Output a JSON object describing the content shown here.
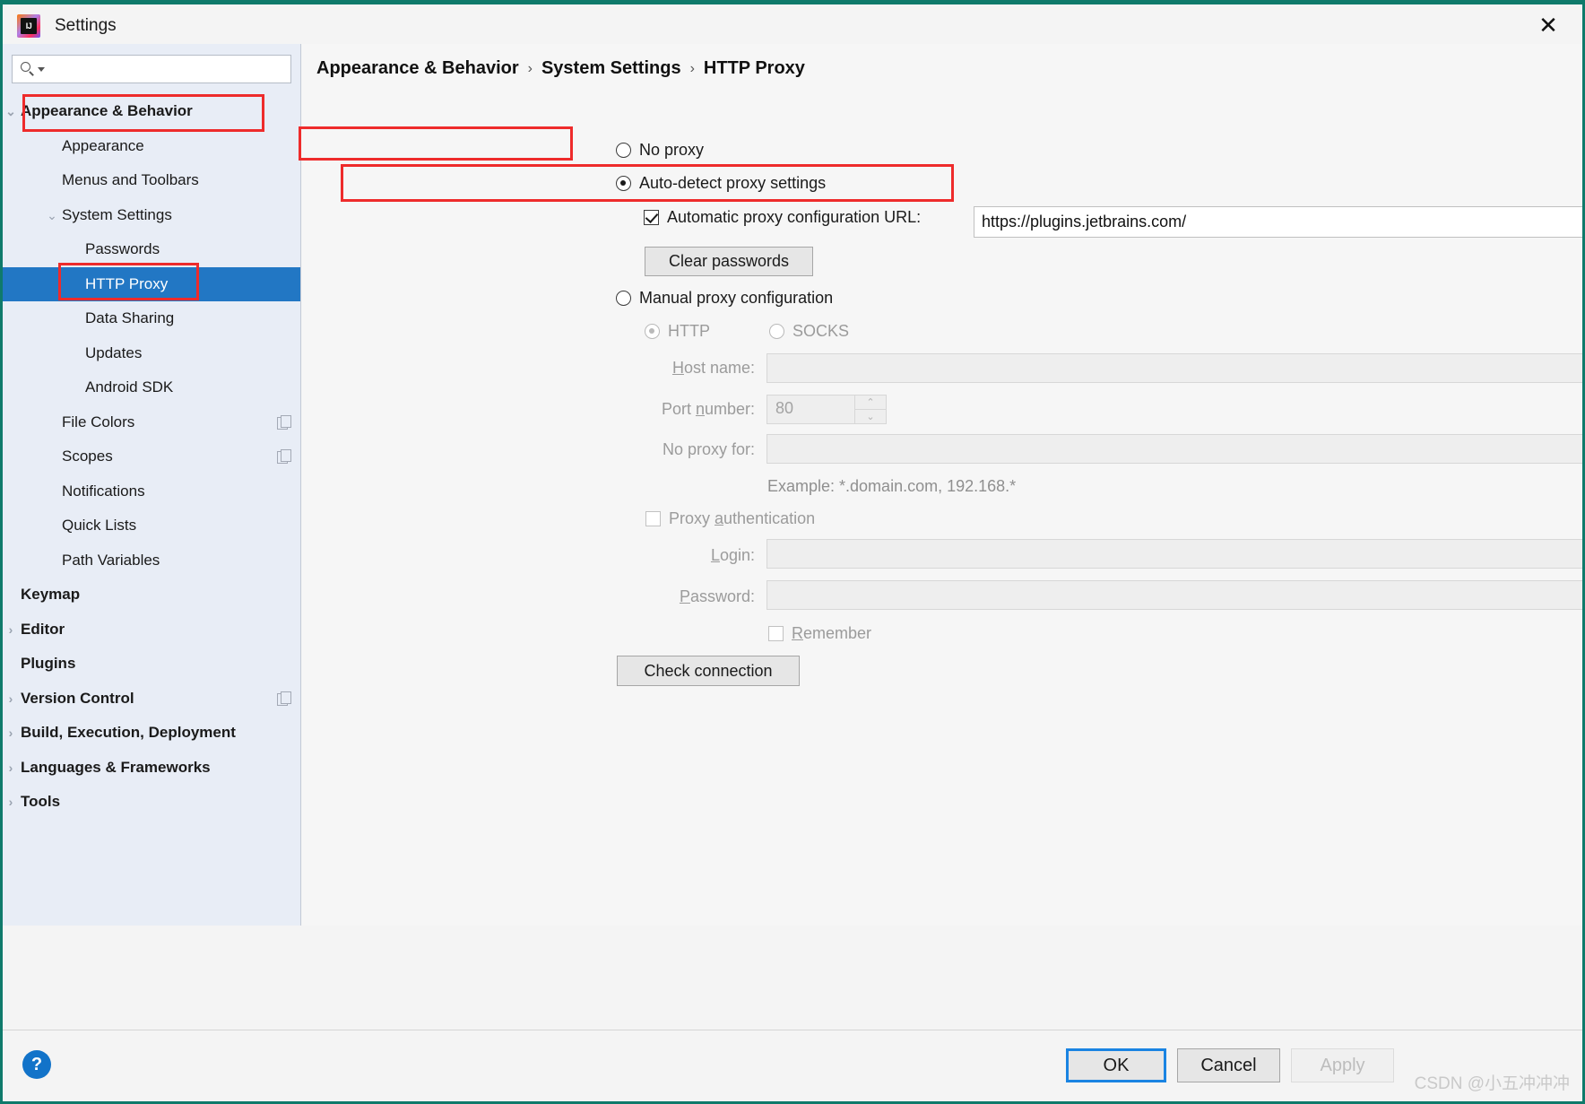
{
  "window": {
    "title": "Settings",
    "logo_text": "IJ",
    "close_icon": "✕"
  },
  "sidebar": {
    "search": {
      "value": "",
      "placeholder": ""
    },
    "items": [
      {
        "label": "Appearance & Behavior",
        "indent": 0,
        "bold": true,
        "twisty": "⌄",
        "selected": false,
        "copy": false
      },
      {
        "label": "Appearance",
        "indent": 1,
        "bold": false,
        "twisty": "",
        "selected": false,
        "copy": false
      },
      {
        "label": "Menus and Toolbars",
        "indent": 1,
        "bold": false,
        "twisty": "",
        "selected": false,
        "copy": false
      },
      {
        "label": "System Settings",
        "indent": 1,
        "bold": false,
        "twisty": "⌄",
        "selected": false,
        "copy": false
      },
      {
        "label": "Passwords",
        "indent": 2,
        "bold": false,
        "twisty": "",
        "selected": false,
        "copy": false
      },
      {
        "label": "HTTP Proxy",
        "indent": 2,
        "bold": false,
        "twisty": "",
        "selected": true,
        "copy": false
      },
      {
        "label": "Data Sharing",
        "indent": 2,
        "bold": false,
        "twisty": "",
        "selected": false,
        "copy": false
      },
      {
        "label": "Updates",
        "indent": 2,
        "bold": false,
        "twisty": "",
        "selected": false,
        "copy": false
      },
      {
        "label": "Android SDK",
        "indent": 2,
        "bold": false,
        "twisty": "",
        "selected": false,
        "copy": false
      },
      {
        "label": "File Colors",
        "indent": 1,
        "bold": false,
        "twisty": "",
        "selected": false,
        "copy": true
      },
      {
        "label": "Scopes",
        "indent": 1,
        "bold": false,
        "twisty": "",
        "selected": false,
        "copy": true
      },
      {
        "label": "Notifications",
        "indent": 1,
        "bold": false,
        "twisty": "",
        "selected": false,
        "copy": false
      },
      {
        "label": "Quick Lists",
        "indent": 1,
        "bold": false,
        "twisty": "",
        "selected": false,
        "copy": false
      },
      {
        "label": "Path Variables",
        "indent": 1,
        "bold": false,
        "twisty": "",
        "selected": false,
        "copy": false
      },
      {
        "label": "Keymap",
        "indent": 0,
        "bold": true,
        "twisty": "",
        "selected": false,
        "copy": false
      },
      {
        "label": "Editor",
        "indent": 0,
        "bold": true,
        "twisty": "›",
        "selected": false,
        "copy": false
      },
      {
        "label": "Plugins",
        "indent": 0,
        "bold": true,
        "twisty": "",
        "selected": false,
        "copy": false
      },
      {
        "label": "Version Control",
        "indent": 0,
        "bold": true,
        "twisty": "›",
        "selected": false,
        "copy": true
      },
      {
        "label": "Build, Execution, Deployment",
        "indent": 0,
        "bold": true,
        "twisty": "›",
        "selected": false,
        "copy": false
      },
      {
        "label": "Languages & Frameworks",
        "indent": 0,
        "bold": true,
        "twisty": "›",
        "selected": false,
        "copy": false
      },
      {
        "label": "Tools",
        "indent": 0,
        "bold": true,
        "twisty": "›",
        "selected": false,
        "copy": false
      }
    ]
  },
  "breadcrumb": {
    "part1": "Appearance & Behavior",
    "sep1": "›",
    "part2": "System Settings",
    "sep2": "›",
    "part3": "HTTP Proxy"
  },
  "proxy": {
    "no_proxy_label": "No proxy",
    "auto_detect_label": "Auto-detect proxy settings",
    "auto_url_label": "Automatic proxy configuration URL:",
    "auto_url_value": "https://plugins.jetbrains.com/",
    "clear_passwords_label": "Clear passwords",
    "manual_label": "Manual proxy configuration",
    "http_label": "HTTP",
    "socks_label": "SOCKS",
    "host_label": "Host name:",
    "host_value": "",
    "port_label": "Port number:",
    "port_value": "80",
    "no_proxy_for_label": "No proxy for:",
    "no_proxy_for_value": "",
    "example_text": "Example: *.domain.com, 192.168.*",
    "proxy_auth_label": "Proxy authentication",
    "login_label": "Login:",
    "login_value": "",
    "password_label": "Password:",
    "password_value": "",
    "remember_label": "Remember",
    "check_connection_label": "Check connection",
    "spin_up_icon": "⌃",
    "spin_down_icon": "⌄",
    "expand_icon": "⤢"
  },
  "footer": {
    "help_icon": "?",
    "ok_label": "OK",
    "cancel_label": "Cancel",
    "apply_label": "Apply",
    "watermark": "CSDN @小五冲冲冲"
  },
  "colors": {
    "selection": "#2277c4",
    "annotation": "#ee2b2b",
    "accent": "#1a84e2"
  }
}
